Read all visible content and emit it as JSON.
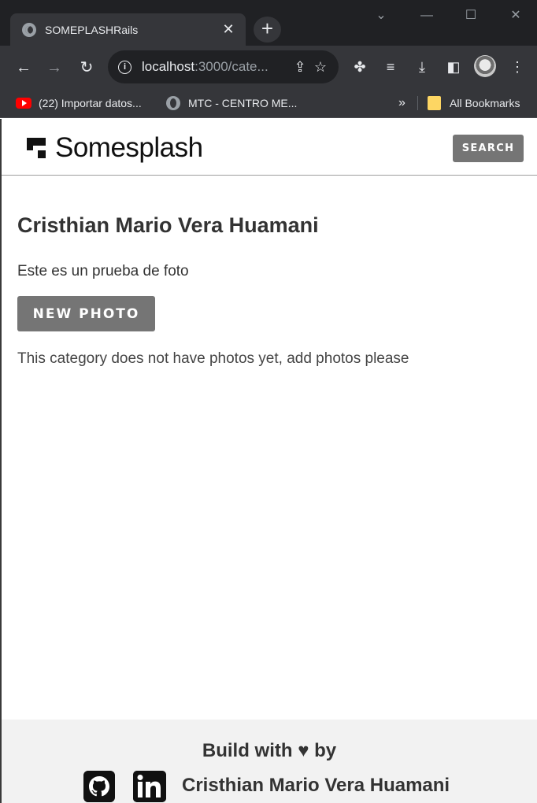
{
  "browser": {
    "tab_title": "SOMEPLASHRails",
    "tab_close": "✕",
    "new_tab": "+",
    "url_host": "localhost",
    "url_rest": ":3000/cate...",
    "bookmarks": [
      {
        "label": "(22) Importar datos...",
        "icon": "youtube-icon"
      },
      {
        "label": "MTC - CENTRO ME...",
        "icon": "globe-icon"
      }
    ],
    "bookmarks_overflow": "»",
    "all_bookmarks": "All Bookmarks"
  },
  "navbar": {
    "brand": "Somesplash",
    "search_label": "SEARCH"
  },
  "category": {
    "title": "Cristhian Mario Vera Huamani",
    "description": "Este es un prueba de foto",
    "new_photo_label": "NEW PHOTO",
    "empty_message": "This category does not have photos yet, add photos please"
  },
  "footer": {
    "build_with": "Build with ♥ by",
    "author": "Cristhian Mario Vera Huamani"
  },
  "colors": {
    "button_gray": "#757575",
    "chrome_dark": "#202124",
    "footer_bg": "#f2f2f2"
  }
}
